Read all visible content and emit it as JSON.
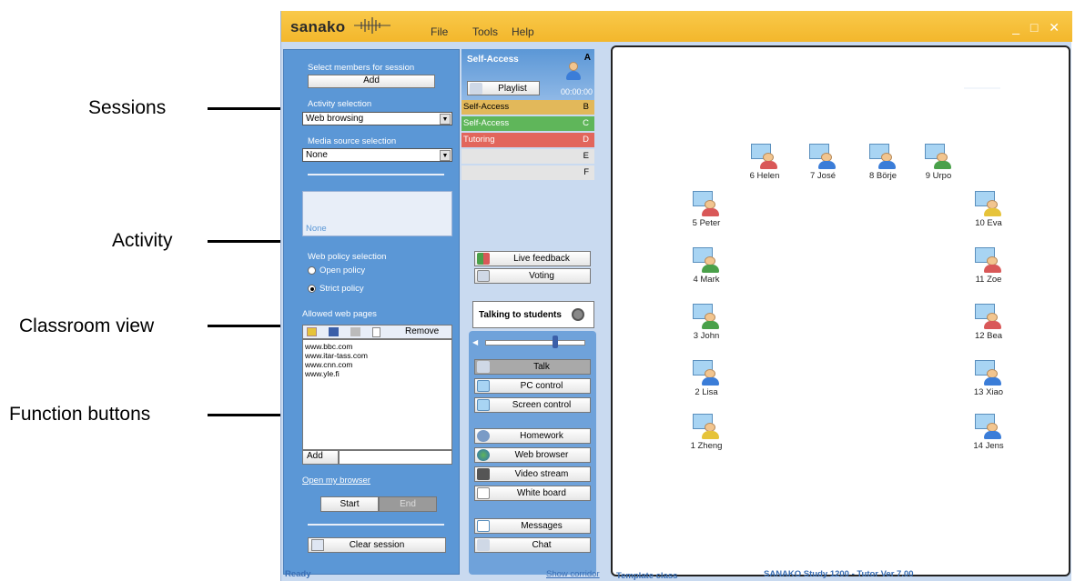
{
  "annotations": {
    "sessions": "Sessions",
    "activity": "Activity",
    "classroom_view": "Classroom view",
    "function_buttons": "Function buttons"
  },
  "app": {
    "logo": "sanako",
    "menu": [
      "File",
      "Tools",
      "Help"
    ],
    "window_controls": "_ □ ✕"
  },
  "left_panel": {
    "select_members_label": "Select members for session",
    "add_button": "Add",
    "activity_selection_label": "Activity selection",
    "activity_value": "Web browsing",
    "media_source_label": "Media source selection",
    "media_source_value": "None",
    "activity_box_text": "None",
    "web_policy_label": "Web policy selection",
    "open_policy": "Open policy",
    "strict_policy": "Strict policy",
    "allowed_pages_label": "Allowed web pages",
    "remove_button": "Remove",
    "allowed_pages": [
      "www.bbc.com",
      "www.itar-tass.com",
      "www.cnn.com",
      "www.yle.fi"
    ],
    "add_page_button": "Add",
    "open_browser_link": "Open my browser",
    "start_button": "Start",
    "end_button": "End",
    "clear_session_button": "Clear session"
  },
  "sessions": {
    "title": "Self-Access",
    "current_letter": "A",
    "playlist_button": "Playlist",
    "timer": "00:00:00",
    "rows": [
      {
        "name": "Self-Access",
        "letter": "B",
        "color": "#e2b85a"
      },
      {
        "name": "Self-Access",
        "letter": "C",
        "color": "#5fb65a"
      },
      {
        "name": "Tutoring",
        "letter": "D",
        "color": "#e2665c"
      },
      {
        "name": "",
        "letter": "E",
        "color": "#e4e4e4"
      },
      {
        "name": "",
        "letter": "F",
        "color": "#e4e4e4"
      }
    ]
  },
  "function_buttons": {
    "live_feedback": "Live feedback",
    "voting": "Voting",
    "talking_to_students": "Talking to students",
    "talk": "Talk",
    "pc_control": "PC control",
    "screen_control": "Screen control",
    "homework": "Homework",
    "web_browser": "Web browser",
    "video_stream": "Video stream",
    "white_board": "White board",
    "messages": "Messages",
    "chat": "Chat"
  },
  "students": [
    {
      "name": "1 Zheng",
      "color": "#e6c33a"
    },
    {
      "name": "2 Lisa",
      "color": "#3b7dd8"
    },
    {
      "name": "3 John",
      "color": "#4aa04a"
    },
    {
      "name": "4 Mark",
      "color": "#4aa04a"
    },
    {
      "name": "5 Peter",
      "color": "#d95858"
    },
    {
      "name": "6 Helen",
      "color": "#d95858"
    },
    {
      "name": "7 José",
      "color": "#3b7dd8"
    },
    {
      "name": "8 Börje",
      "color": "#3b7dd8"
    },
    {
      "name": "9 Urpo",
      "color": "#4aa04a"
    },
    {
      "name": "10 Eva",
      "color": "#e6c33a"
    },
    {
      "name": "11 Zoe",
      "color": "#d95858"
    },
    {
      "name": "12 Bea",
      "color": "#d95858"
    },
    {
      "name": "13 Xiao",
      "color": "#3b7dd8"
    },
    {
      "name": "14 Jens",
      "color": "#3b7dd8"
    }
  ],
  "status_bar": {
    "ready": "Ready",
    "show_corridor": "Show corridor",
    "template_class": "Template class",
    "version": "SANAKO Study 1200 - Tutor Ver 7.00"
  }
}
